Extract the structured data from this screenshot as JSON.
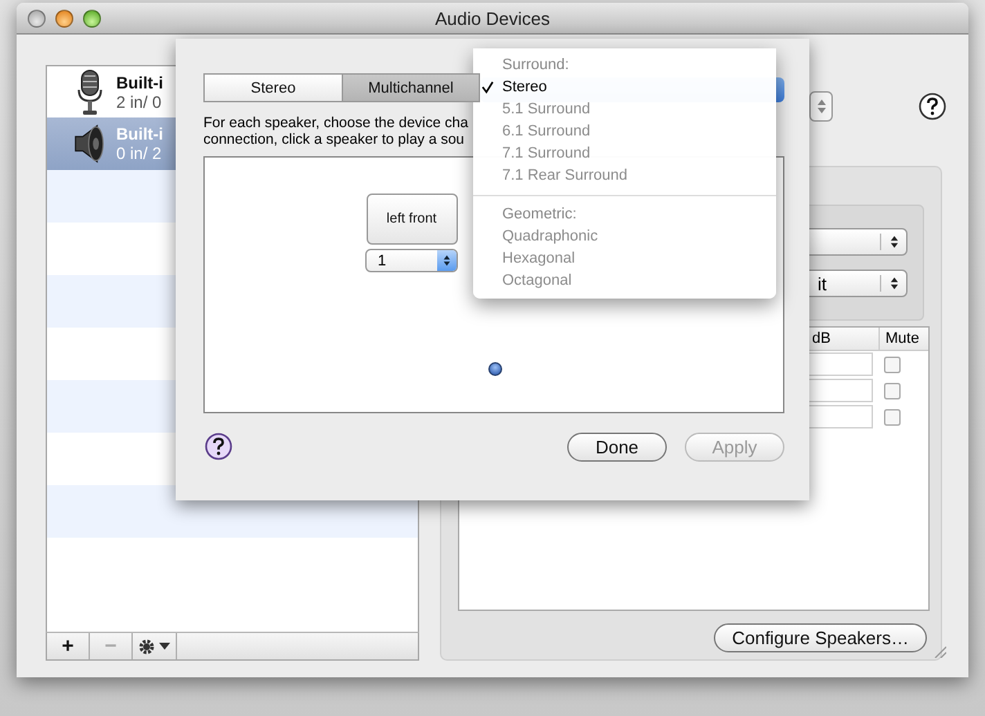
{
  "window": {
    "title": "Audio Devices"
  },
  "devices": [
    {
      "name": "Built-i",
      "channels": "2 in/ 0",
      "kind": "microphone",
      "selected": false
    },
    {
      "name": "Built-i",
      "channels": "0 in/ 2",
      "kind": "speaker",
      "selected": true
    }
  ],
  "list_toolbar": [
    {
      "label": "+",
      "disabled": false
    },
    {
      "label": "−",
      "disabled": true
    }
  ],
  "format": {
    "value": "it"
  },
  "volume_table": {
    "columns": [
      "dB",
      "Mute"
    ],
    "rows": [
      {
        "muted": false
      },
      {
        "muted": false
      },
      {
        "muted": false
      }
    ]
  },
  "configure_button": "Configure Speakers…",
  "sheet": {
    "tabs": [
      {
        "label": "Stereo",
        "selected": false
      },
      {
        "label": "Multichannel",
        "selected": true
      }
    ],
    "instructions": [
      "For each speaker, choose the device cha",
      "connection, click a speaker to play a sou"
    ],
    "speakers": [
      {
        "label": "left front",
        "channel": "1"
      }
    ],
    "buttons": [
      {
        "label": "Done",
        "disabled": false
      },
      {
        "label": "Apply",
        "disabled": true
      }
    ]
  },
  "menu": {
    "items": [
      {
        "kind": "header",
        "label": "Surround:"
      },
      {
        "kind": "item",
        "label": "Stereo",
        "checked": true,
        "disabled": false
      },
      {
        "kind": "item",
        "label": "5.1 Surround",
        "checked": false,
        "disabled": true
      },
      {
        "kind": "item",
        "label": "6.1 Surround",
        "checked": false,
        "disabled": true
      },
      {
        "kind": "item",
        "label": "7.1 Surround",
        "checked": false,
        "disabled": true
      },
      {
        "kind": "item",
        "label": "7.1 Rear Surround",
        "checked": false,
        "disabled": true
      },
      {
        "kind": "separator"
      },
      {
        "kind": "header",
        "label": "Geometric:"
      },
      {
        "kind": "item",
        "label": "Quadraphonic",
        "checked": false,
        "disabled": true
      },
      {
        "kind": "item",
        "label": "Hexagonal",
        "checked": false,
        "disabled": true
      },
      {
        "kind": "item",
        "label": "Octagonal",
        "checked": false,
        "disabled": true
      }
    ]
  }
}
